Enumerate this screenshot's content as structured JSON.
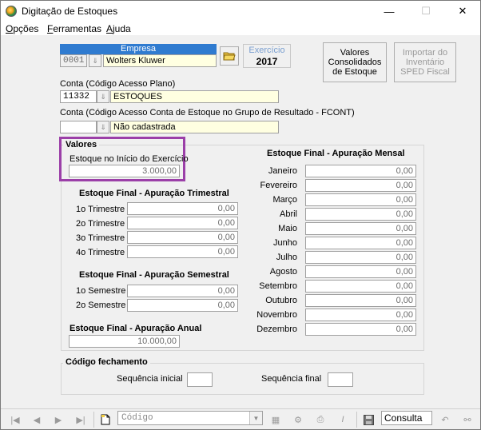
{
  "window": {
    "title": "Digitação de Estoques",
    "minimize": "—",
    "maximize": "☐",
    "close": "✕"
  },
  "menu": [
    {
      "label": "Opções",
      "u": "O",
      "rest": "pções"
    },
    {
      "label": "Ferramentas",
      "u": "F",
      "rest": "erramentas"
    },
    {
      "label": "Ajuda",
      "u": "A",
      "rest": "juda"
    }
  ],
  "empresa": {
    "header": "Empresa",
    "code": "0001",
    "name": "Wolters Kluwer"
  },
  "exercicio": {
    "label": "Exercício",
    "value": "2017"
  },
  "buttons": {
    "valores_consolidados": "Valores Consolidados de Estoque",
    "importar_inventario": "Importar do Inventário SPED Fiscal"
  },
  "conta": {
    "label": "Conta (Código Acesso Plano)",
    "code": "11332",
    "name": "ESTOQUES"
  },
  "conta_fcont": {
    "label": "Conta (Código Acesso Conta de Estoque no Grupo de Resultado - FCONT)",
    "code": "",
    "name": "Não cadastrada"
  },
  "valores": {
    "title": "Valores",
    "inicio_label": "Estoque no Início do Exercício",
    "inicio_value": "3.000,00"
  },
  "trimestral": {
    "title": "Estoque Final - Apuração Trimestral",
    "rows": [
      {
        "label": "1o Trimestre",
        "value": "0,00"
      },
      {
        "label": "2o Trimestre",
        "value": "0,00"
      },
      {
        "label": "3o Trimestre",
        "value": "0,00"
      },
      {
        "label": "4o Trimestre",
        "value": "0,00"
      }
    ]
  },
  "semestral": {
    "title": "Estoque Final - Apuração Semestral",
    "rows": [
      {
        "label": "1o Semestre",
        "value": "0,00"
      },
      {
        "label": "2o Semestre",
        "value": "0,00"
      }
    ]
  },
  "anual": {
    "title": "Estoque Final - Apuração Anual",
    "value": "10.000,00"
  },
  "mensal": {
    "title": "Estoque Final - Apuração Mensal",
    "rows": [
      {
        "label": "Janeiro",
        "value": "0,00"
      },
      {
        "label": "Fevereiro",
        "value": "0,00"
      },
      {
        "label": "Março",
        "value": "0,00"
      },
      {
        "label": "Abril",
        "value": "0,00"
      },
      {
        "label": "Maio",
        "value": "0,00"
      },
      {
        "label": "Junho",
        "value": "0,00"
      },
      {
        "label": "Julho",
        "value": "0,00"
      },
      {
        "label": "Agosto",
        "value": "0,00"
      },
      {
        "label": "Setembro",
        "value": "0,00"
      },
      {
        "label": "Outubro",
        "value": "0,00"
      },
      {
        "label": "Novembro",
        "value": "0,00"
      },
      {
        "label": "Dezembro",
        "value": "0,00"
      }
    ]
  },
  "fechamento": {
    "title": "Código fechamento",
    "inicial_label": "Sequência inicial",
    "inicial_value": "",
    "final_label": "Sequência final",
    "final_value": ""
  },
  "toolbar": {
    "combo_value": "Código",
    "status": "Consulta"
  },
  "colors": {
    "empresa_header": "#2f7bd0",
    "highlight": "#9b3fa8",
    "yellow_field": "#ffffe1"
  }
}
